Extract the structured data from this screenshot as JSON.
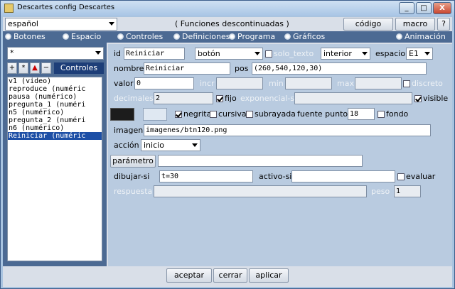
{
  "window": {
    "title": "Descartes config Descartes",
    "min": "_",
    "max": "□",
    "close": "X"
  },
  "topbar": {
    "language": "español",
    "center_text": "( Funciones  descontinuadas )",
    "codigo": "código",
    "macro": "macro",
    "help": "?"
  },
  "tabs": [
    {
      "label": "Botones"
    },
    {
      "label": "Espacio"
    },
    {
      "label": "Controles"
    },
    {
      "label": "Definiciones"
    },
    {
      "label": "Programa"
    },
    {
      "label": "Gráficos"
    },
    {
      "label": "Animación"
    }
  ],
  "left": {
    "filter": "*",
    "btn_add": "+",
    "btn_star": "*",
    "btn_dn": "▲",
    "btn_minus": "−",
    "title": "Controles",
    "items": [
      "v1 (video)",
      "reproduce (numéric",
      "pausa (numérico)",
      "pregunta_1 (numéri",
      "n5 (numérico)",
      "pregunta_2 (numéri",
      "n6 (numérico)",
      "Reiniciar (numéric"
    ]
  },
  "form": {
    "id_label": "id",
    "id_value": "Reiniciar",
    "type": "botón",
    "solo_texto": "solo_texto",
    "region": "interior",
    "espacio_label": "espacio",
    "espacio": "E1",
    "nombre_label": "nombre",
    "nombre_value": "Reiniciar",
    "pos_label": "pos",
    "pos_value": "(260,540,120,30)",
    "valor_label": "valor",
    "valor_value": "0",
    "incr_label": "incr",
    "min_label": "min",
    "max_label": "max",
    "discreto_label": "discreto",
    "decimales_label": "decimales",
    "decimales_value": "2",
    "fijo_label": "fijo",
    "exponencial_label": "exponencial-si",
    "visible_label": "visible",
    "negrita": "negrita",
    "cursiva": "cursiva",
    "subrayada": "subrayada",
    "fuente_label": "fuente puntos",
    "fuente_value": "18",
    "fondo": "fondo",
    "imagen_label": "imagen",
    "imagen_value": "imagenes/btn120.png",
    "accion_label": "acción",
    "accion_value": "inicio",
    "parametro_label": "parámetro",
    "parametro_value": "",
    "dibujar_label": "dibujar-si",
    "dibujar_value": "t=30",
    "activo_label": "activo-si",
    "activo_value": "",
    "evaluar": "evaluar",
    "respuesta_label": "respuesta",
    "peso_label": "peso",
    "peso_value": "1",
    "color_dark": "#1c1c1c",
    "color_light": "#dfe8f2"
  },
  "footer": {
    "aceptar": "aceptar",
    "cerrar": "cerrar",
    "aplicar": "aplicar"
  }
}
